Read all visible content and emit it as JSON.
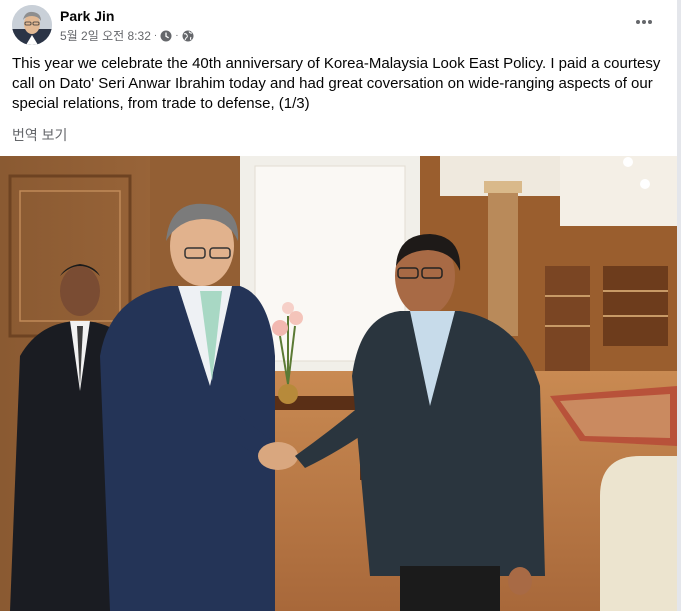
{
  "post": {
    "author": "Park Jin",
    "date": "5월 2일 오전 8:32",
    "separator": "·",
    "menu_icon": "more-horizontal-icon",
    "text": "This year we celebrate the 40th anniversary of Korea-Malaysia Look East Policy. I paid a courtesy call on Dato' Seri Anwar Ibrahim today and had great coversation on wide-ranging aspects of our special relations, from trade to defense, (1/3)",
    "translate_label": "번역 보기"
  }
}
